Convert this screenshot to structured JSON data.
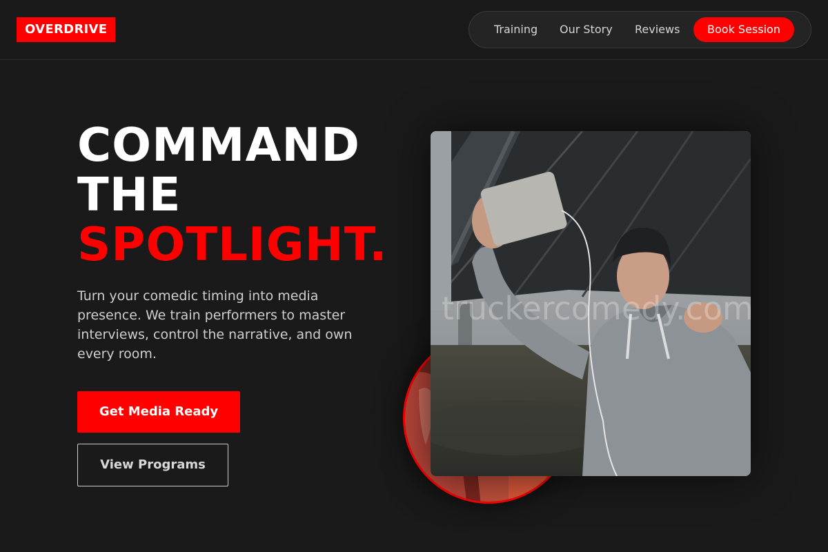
{
  "header": {
    "logo": "OVERDRIVE",
    "nav": {
      "items": [
        "Training",
        "Our Story",
        "Reviews"
      ],
      "cta": "Book Session"
    }
  },
  "hero": {
    "title_lines": [
      "COMMAND",
      "THE"
    ],
    "title_accent": "SPOTLIGHT.",
    "description": "Turn your comedic timing into media presence. We train performers to master interviews, control the narrative, and own every room.",
    "primary_button": "Get Media Ready",
    "secondary_button": "View Programs"
  },
  "media": {
    "watermark": "truckercomedy.com"
  },
  "colors": {
    "accent": "#ff0000",
    "background": "#1a1a1a",
    "nav_background": "#242424"
  },
  "icons": [
    "photo-performer-selfie",
    "photo-crowd-circle"
  ]
}
